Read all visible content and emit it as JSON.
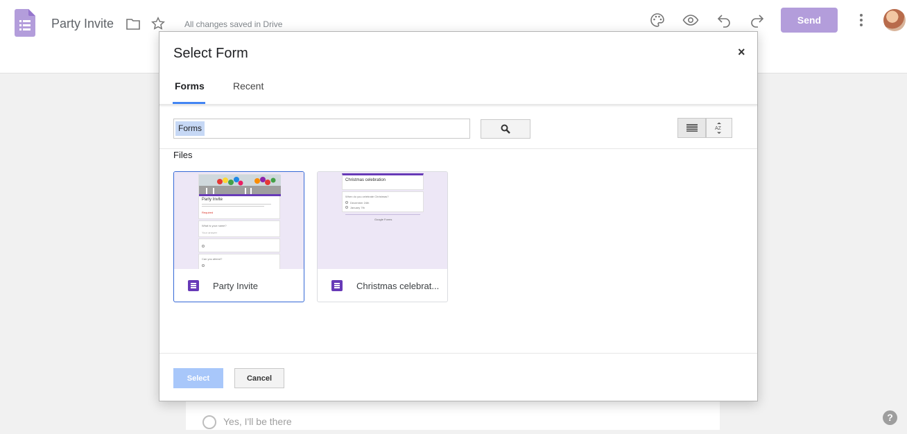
{
  "header": {
    "doc_title": "Party Invite",
    "save_status": "All changes saved in Drive",
    "send_label": "Send",
    "icons": [
      "forms-logo-icon",
      "folder-icon",
      "star-icon",
      "palette-icon",
      "eye-icon",
      "undo-icon",
      "redo-icon",
      "more-vert-icon"
    ]
  },
  "background": {
    "option_text": "Yes,  I'll be there",
    "help": "?"
  },
  "dialog": {
    "title": "Select Form",
    "close": "×",
    "tabs": [
      {
        "label": "Forms",
        "active": true
      },
      {
        "label": "Recent",
        "active": false
      }
    ],
    "search": {
      "value": "Forms"
    },
    "sort_label": "AZ",
    "files_label": "Files",
    "files": [
      {
        "name": "Party Invite",
        "selected": true,
        "thumb": {
          "title": "Party Invite",
          "question_1": "What is your name?",
          "answer_hint": "Your answer",
          "question_2": "Can you attend?",
          "required": "Required"
        }
      },
      {
        "name": "Christmas celebrat...",
        "selected": false,
        "thumb": {
          "title": "Christmas celebration",
          "question_1": "When do you celebrate Christmas?",
          "option_1": "December 24th",
          "option_2": "January 7th",
          "footer": "Google Forms"
        }
      }
    ],
    "select_label": "Select",
    "cancel_label": "Cancel"
  },
  "colors": {
    "brand_purple": "#673ab7",
    "send_button": "#b39ddb",
    "tab_accent": "#4285f4",
    "selected_border": "#3367d6"
  }
}
